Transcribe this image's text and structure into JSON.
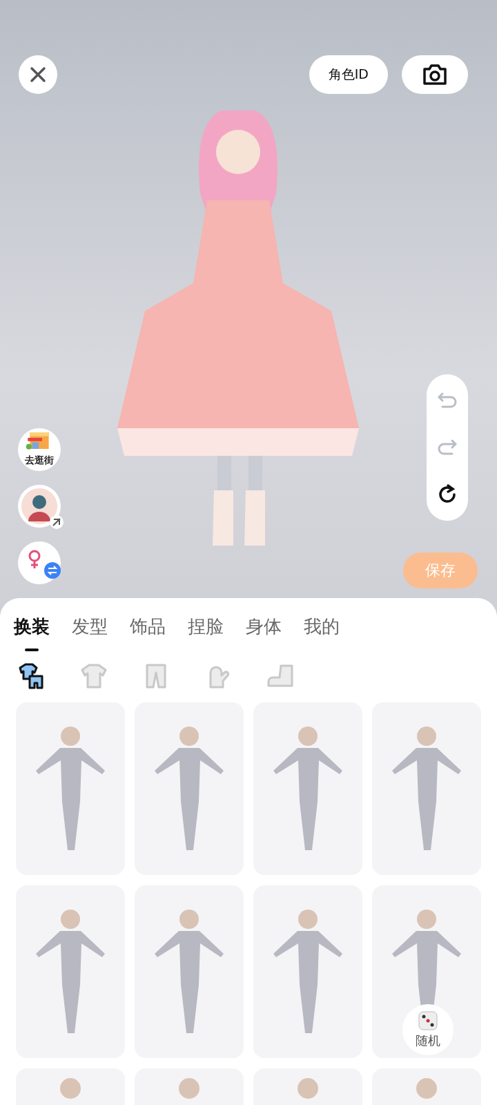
{
  "top_bar": {
    "role_id_button": "角色ID"
  },
  "side_actions": [
    {
      "kind": "shop",
      "label": "去逛街"
    },
    {
      "kind": "avatar"
    },
    {
      "kind": "gender"
    }
  ],
  "history": [
    {
      "kind": "undo",
      "disabled": true
    },
    {
      "kind": "redo",
      "disabled": true
    },
    {
      "kind": "reset",
      "disabled": false
    }
  ],
  "save_button": "保存",
  "tabs": [
    {
      "label": "换装",
      "selected": true
    },
    {
      "label": "发型",
      "selected": false
    },
    {
      "label": "饰品",
      "selected": false
    },
    {
      "label": "捏脸",
      "selected": false
    },
    {
      "label": "身体",
      "selected": false
    },
    {
      "label": "我的",
      "selected": false
    }
  ],
  "categories": [
    {
      "kind": "outfit",
      "selected": true
    },
    {
      "kind": "top",
      "selected": false
    },
    {
      "kind": "pants",
      "selected": false
    },
    {
      "kind": "glove",
      "selected": false
    },
    {
      "kind": "shoe",
      "selected": false
    }
  ],
  "outfits": [
    {
      "kind": "outfit"
    },
    {
      "kind": "outfit"
    },
    {
      "kind": "outfit"
    },
    {
      "kind": "outfit"
    },
    {
      "kind": "outfit"
    },
    {
      "kind": "outfit"
    },
    {
      "kind": "outfit"
    },
    {
      "kind": "outfit"
    },
    {
      "kind": "peek"
    },
    {
      "kind": "peek"
    },
    {
      "kind": "peek"
    },
    {
      "kind": "peek"
    }
  ],
  "random_button": "随机"
}
